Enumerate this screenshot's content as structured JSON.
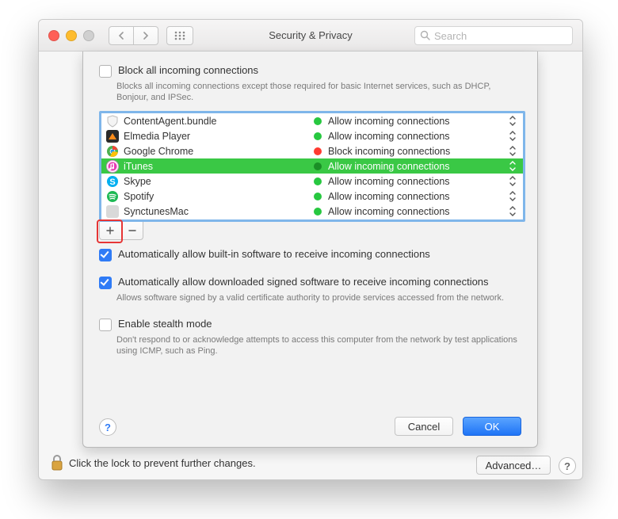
{
  "window": {
    "title": "Security & Privacy",
    "search_placeholder": "Search"
  },
  "sheet": {
    "block_all": {
      "label": "Block all incoming connections",
      "desc": "Blocks all incoming connections except those required for basic Internet services,  such as DHCP, Bonjour, and IPSec."
    },
    "apps": [
      {
        "name": "ContentAgent.bundle",
        "status": "Allow incoming connections",
        "allow": true,
        "icon": "shield",
        "sel": false
      },
      {
        "name": "Elmedia Player",
        "status": "Allow incoming connections",
        "allow": true,
        "icon": "elmedia",
        "sel": false
      },
      {
        "name": "Google Chrome",
        "status": "Block incoming connections",
        "allow": false,
        "icon": "chrome",
        "sel": false
      },
      {
        "name": "iTunes",
        "status": "Allow incoming connections",
        "allow": true,
        "icon": "itunes",
        "sel": true
      },
      {
        "name": "Skype",
        "status": "Allow incoming connections",
        "allow": true,
        "icon": "skype",
        "sel": false
      },
      {
        "name": "Spotify",
        "status": "Allow incoming connections",
        "allow": true,
        "icon": "spotify",
        "sel": false
      },
      {
        "name": "SynctunesMac",
        "status": "Allow incoming connections",
        "allow": true,
        "icon": "generic",
        "sel": false
      }
    ],
    "auto_builtin": "Automatically allow built-in software to receive incoming connections",
    "auto_signed": {
      "label": "Automatically allow downloaded signed software to receive incoming connections",
      "desc": "Allows software signed by a valid certificate authority to provide services accessed from the network."
    },
    "stealth": {
      "label": "Enable stealth mode",
      "desc": "Don't respond to or acknowledge attempts to access this computer from the network by test applications using ICMP, such as Ping."
    },
    "cancel": "Cancel",
    "ok": "OK"
  },
  "footer": {
    "lock_text": "Click the lock to prevent further changes.",
    "advanced": "Advanced…"
  }
}
